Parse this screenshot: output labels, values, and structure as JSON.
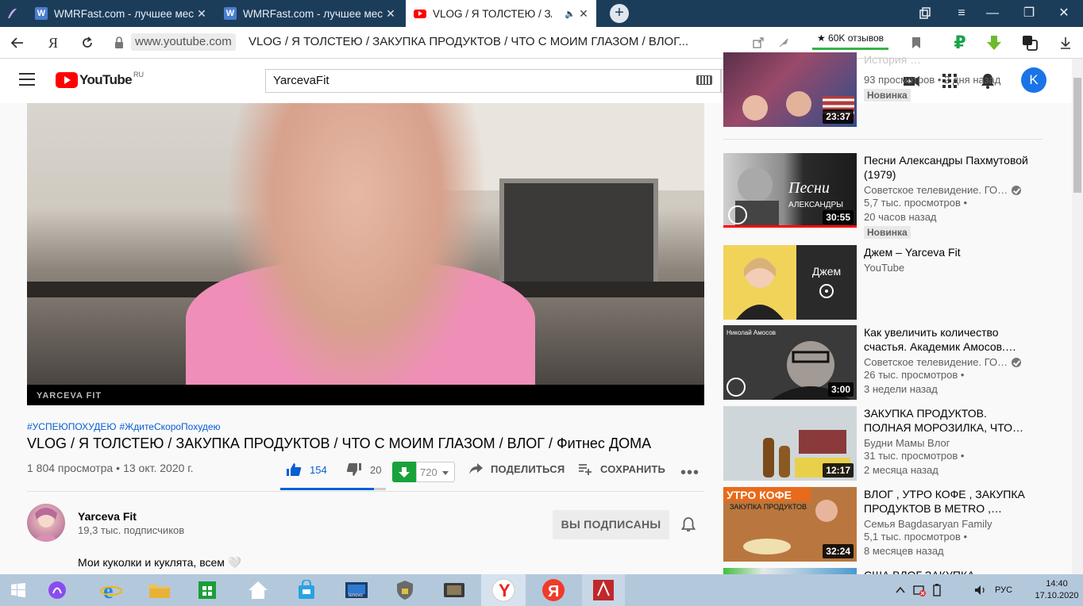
{
  "browser": {
    "tabs": [
      {
        "title": "WMRFast.com - лучшее мес",
        "fav": "W",
        "active": false
      },
      {
        "title": "WMRFast.com - лучшее мес",
        "fav": "W",
        "active": false
      },
      {
        "title": "VLOG / Я ТОЛСТЕЮ / ЗАК",
        "fav": "youtube-icon",
        "active": true
      }
    ],
    "url_domain": "www.youtube.com",
    "url_title": "VLOG / Я ТОЛСТЕЮ / ЗАКУПКА ПРОДУКТОВ / ЧТО С МОИМ ГЛАЗОМ / ВЛОГ...",
    "reviews": "★ 60K отзывов",
    "ya": "Я"
  },
  "youtube": {
    "logo_text": "YouTube",
    "region": "RU",
    "search_value": "YarcevaFit",
    "avatar_letter": "K"
  },
  "video": {
    "watermark": "YARCEVA FIT",
    "tags": [
      "#УСПЕЮПОХУДЕЮ",
      "#ЖдитеСкороПохудею"
    ],
    "title": "VLOG / Я ТОЛСТЕЮ / ЗАКУПКА ПРОДУКТОВ / ЧТО С МОИМ ГЛАЗОМ / ВЛОГ / Фитнес ДОМА",
    "views": "1 804 просмотра",
    "date": "13 окт. 2020 г.",
    "likes": "154",
    "dislikes": "20",
    "like_ratio": 0.885,
    "download_count": "720",
    "share_label": "ПОДЕЛИТЬСЯ",
    "save_label": "СОХРАНИТЬ"
  },
  "channel": {
    "name": "Yarceva Fit",
    "subscribers": "19,3 тыс. подписчиков",
    "subscribed_label": "ВЫ ПОДПИСАНЫ",
    "description": "Мои куколки и куклята, всем 🤍"
  },
  "sidebar": {
    "items": [
      {
        "title": "История …",
        "channel": "",
        "line1": "93 просмотров",
        "line2": "2 дня назад",
        "duration": "23:37",
        "badge": "Новинка",
        "verified": false
      },
      {
        "title": "Песни Александры Пахмутовой (1979)",
        "channel": "Советское телевидение. ГО…",
        "line1": "5,7 тыс. просмотров",
        "line2": "20 часов назад",
        "duration": "30:55",
        "badge": "Новинка",
        "verified": true
      },
      {
        "title": "Джем – Yarceva Fit",
        "channel": "YouTube",
        "line1": "",
        "line2": "",
        "duration": "",
        "badge": "",
        "verified": false,
        "thumb_label": "Джем"
      },
      {
        "title": "Как увеличить количество счастья. Академик Амосов.…",
        "channel": "Советское телевидение. ГО…",
        "line1": "26 тыс. просмотров",
        "line2": "3 недели назад",
        "duration": "3:00",
        "badge": "",
        "verified": true
      },
      {
        "title": "ЗАКУПКА ПРОДУКТОВ. ПОЛНАЯ МОРОЗИЛКА, ЧТО…",
        "channel": "Будни Мамы Влог",
        "line1": "31 тыс. просмотров",
        "line2": "2 месяца назад",
        "duration": "12:17",
        "badge": "",
        "verified": false
      },
      {
        "title": "ВЛОГ , УТРО КОФЕ , ЗАКУПКА ПРОДУКТОВ В METRO ,…",
        "channel": "Семья Bagdasaryan Family",
        "line1": "5,1 тыс. просмотров",
        "line2": "8 месяцев назад",
        "duration": "32:24",
        "badge": "",
        "verified": false
      },
      {
        "title": "США ВЛОГ ЗАКУПКА",
        "channel": "",
        "line1": "",
        "line2": "",
        "duration": "",
        "badge": "",
        "verified": false
      }
    ],
    "thumb_colors": [
      "#6c3b5a",
      "#3a3a3a",
      "#e2b23a",
      "#2c2c2c",
      "#7e8a80",
      "#b46a3a",
      "#4a9ad0"
    ]
  },
  "taskbar": {
    "lang": "РУС",
    "time": "14:40",
    "date": "17.10.2020"
  }
}
